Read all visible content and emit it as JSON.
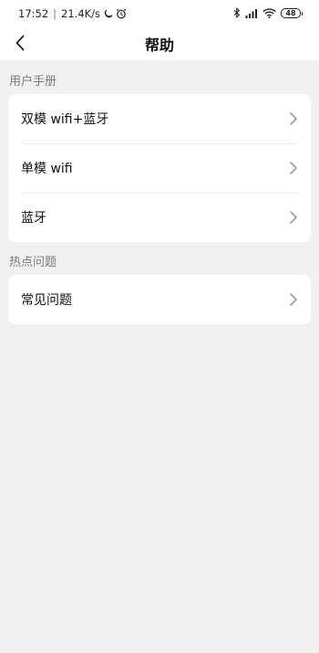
{
  "status_bar": {
    "time": "17:52",
    "separator": "|",
    "net_speed": "21.4K/s",
    "battery": "48",
    "icons": [
      "moon-icon",
      "alarm-icon",
      "bluetooth-icon",
      "signal-icon",
      "wifi-icon",
      "battery-icon"
    ]
  },
  "nav": {
    "title": "帮助",
    "back_icon": "chevron-left-icon"
  },
  "manual": {
    "header": "用户手册",
    "items": [
      {
        "label": "双模 wifi+蓝牙"
      },
      {
        "label": "单模 wifi"
      },
      {
        "label": "蓝牙"
      }
    ]
  },
  "hot": {
    "header": "热点问题",
    "items": [
      {
        "label": "常见问题"
      }
    ]
  },
  "colors": {
    "background": "#f1f1f1",
    "card": "#ffffff",
    "section_header_text": "#7a7a7a",
    "chevron": "#9a9a9a"
  }
}
